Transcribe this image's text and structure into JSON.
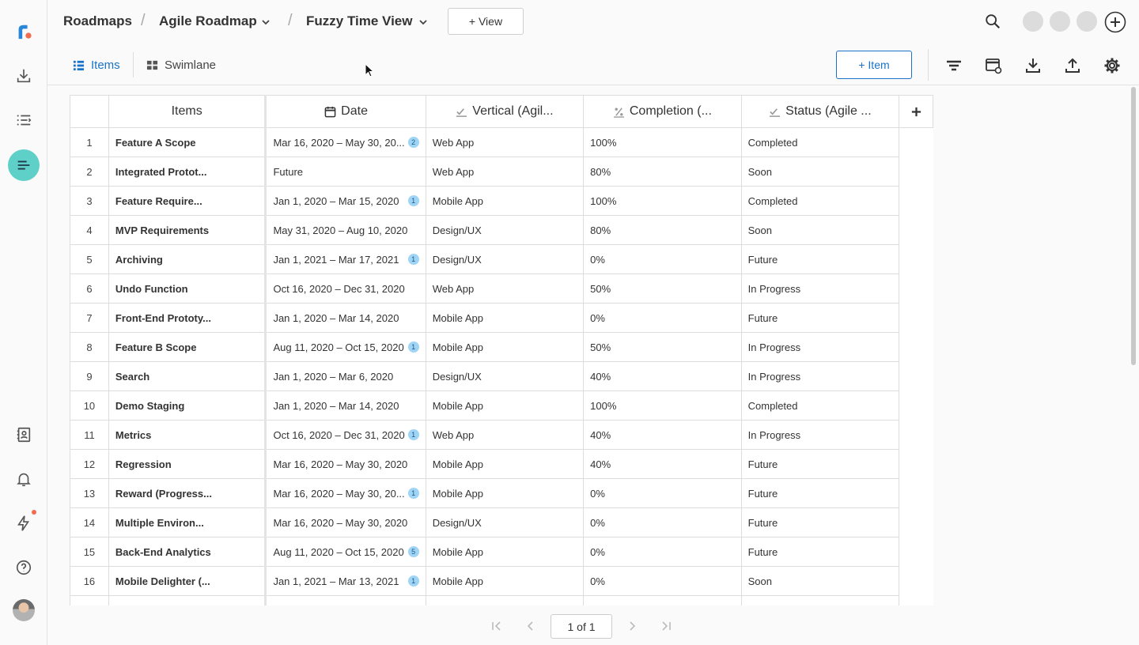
{
  "breadcrumb": {
    "root": "Roadmaps",
    "roadmap": "Agile Roadmap",
    "view": "Fuzzy Time View",
    "add_view_label": "+ View"
  },
  "toolbar": {
    "tabs": [
      {
        "label": "Items",
        "active": true
      },
      {
        "label": "Swimlane",
        "active": false
      }
    ],
    "add_item_label": "+ Item"
  },
  "table": {
    "columns": [
      "Items",
      "Date",
      "Vertical (Agil...",
      "Completion (...",
      "Status (Agile ..."
    ],
    "add_column_label": "+",
    "rows": [
      {
        "num": "1",
        "name": "Feature A Scope",
        "date": "Mar 16, 2020 – May 30, 20...",
        "badge": "2",
        "vertical": "Web App",
        "completion": "100%",
        "status": "Completed"
      },
      {
        "num": "2",
        "name": "Integrated Protot...",
        "date": "Future",
        "badge": "",
        "vertical": "Web App",
        "completion": "80%",
        "status": "Soon"
      },
      {
        "num": "3",
        "name": "Feature Require...",
        "date": "Jan 1, 2020 – Mar 15, 2020",
        "badge": "1",
        "vertical": "Mobile App",
        "completion": "100%",
        "status": "Completed"
      },
      {
        "num": "4",
        "name": "MVP Requirements",
        "date": "May 31, 2020 – Aug 10, 2020",
        "badge": "",
        "vertical": "Design/UX",
        "completion": "80%",
        "status": "Soon"
      },
      {
        "num": "5",
        "name": "Archiving",
        "date": "Jan 1, 2021 – Mar 17, 2021",
        "badge": "1",
        "vertical": "Design/UX",
        "completion": "0%",
        "status": "Future"
      },
      {
        "num": "6",
        "name": "Undo Function",
        "date": "Oct 16, 2020 – Dec 31, 2020",
        "badge": "",
        "vertical": "Web App",
        "completion": "50%",
        "status": "In Progress"
      },
      {
        "num": "7",
        "name": "Front-End Prototy...",
        "date": "Jan 1, 2020 – Mar 14, 2020",
        "badge": "",
        "vertical": "Mobile App",
        "completion": "0%",
        "status": "Future"
      },
      {
        "num": "8",
        "name": "Feature B Scope",
        "date": "Aug 11, 2020 – Oct 15, 2020",
        "badge": "1",
        "vertical": "Mobile App",
        "completion": "50%",
        "status": "In Progress"
      },
      {
        "num": "9",
        "name": "Search",
        "date": "Jan 1, 2020 – Mar 6, 2020",
        "badge": "",
        "vertical": "Design/UX",
        "completion": "40%",
        "status": "In Progress"
      },
      {
        "num": "10",
        "name": "Demo Staging",
        "date": "Jan 1, 2020 – Mar 14, 2020",
        "badge": "",
        "vertical": "Mobile App",
        "completion": "100%",
        "status": "Completed"
      },
      {
        "num": "11",
        "name": "Metrics",
        "date": "Oct 16, 2020 – Dec 31, 2020",
        "badge": "1",
        "vertical": "Web App",
        "completion": "40%",
        "status": "In Progress"
      },
      {
        "num": "12",
        "name": "Regression",
        "date": "Mar 16, 2020 – May 30, 2020",
        "badge": "",
        "vertical": "Mobile App",
        "completion": "40%",
        "status": "Future"
      },
      {
        "num": "13",
        "name": "Reward (Progress...",
        "date": "Mar 16, 2020 – May 30, 20...",
        "badge": "1",
        "vertical": "Mobile App",
        "completion": "0%",
        "status": "Future"
      },
      {
        "num": "14",
        "name": "Multiple Environ...",
        "date": "Mar 16, 2020 – May 30, 2020",
        "badge": "",
        "vertical": "Design/UX",
        "completion": "0%",
        "status": "Future"
      },
      {
        "num": "15",
        "name": "Back-End Analytics",
        "date": "Aug 11, 2020 – Oct 15, 2020",
        "badge": "5",
        "vertical": "Mobile App",
        "completion": "0%",
        "status": "Future"
      },
      {
        "num": "16",
        "name": "Mobile Delighter (...",
        "date": "Jan 1, 2021 – Mar 13, 2021",
        "badge": "1",
        "vertical": "Mobile App",
        "completion": "0%",
        "status": "Soon"
      },
      {
        "num": "",
        "name": "",
        "date": "",
        "badge": "",
        "vertical": "",
        "completion": "",
        "status": ""
      }
    ]
  },
  "pagination": {
    "page_label": "1 of 1"
  },
  "colors": {
    "accent": "#1a73c8",
    "active_nav": "#5fd0c8",
    "badge": "#9fd4f5",
    "notification_dot": "#f26c4f"
  }
}
